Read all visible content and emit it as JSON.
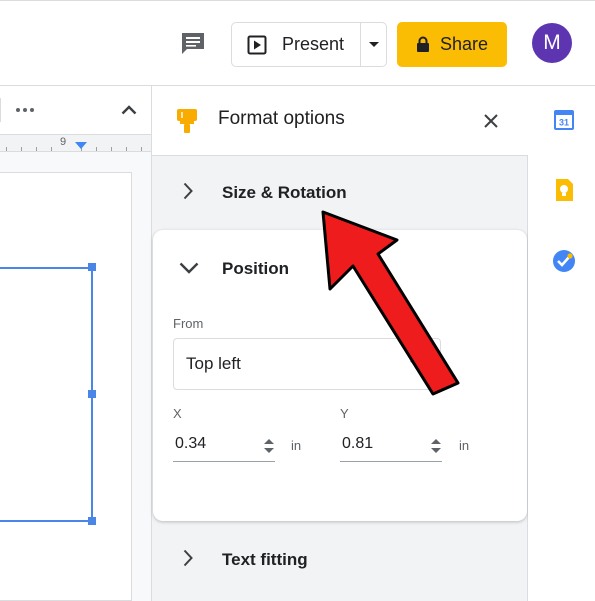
{
  "header": {
    "present_label": "Present",
    "share_label": "Share",
    "avatar_initial": "M",
    "icons": [
      "comment-icon",
      "present-icon",
      "dropdown-caret-icon",
      "lock-icon"
    ],
    "colors": {
      "share": "#fbbc04",
      "avatar": "#5e35b1"
    }
  },
  "toolbar": {
    "icons": [
      "more-icon",
      "collapse-icon"
    ]
  },
  "ruler": {
    "visible_number": "9"
  },
  "format_panel": {
    "title": "Format options",
    "icons": [
      "paint-brush-icon",
      "close-icon"
    ],
    "sections": {
      "size_rotation": {
        "label": "Size & Rotation",
        "expanded": false
      },
      "position": {
        "label": "Position",
        "expanded": true,
        "from_label": "From",
        "from_value": "Top left",
        "x_label": "X",
        "x_value": "0.34",
        "x_unit": "in",
        "y_label": "Y",
        "y_value": "0.81",
        "y_unit": "in"
      },
      "text_fitting": {
        "label": "Text fitting",
        "expanded": false
      }
    }
  },
  "right_sidebar": {
    "icons": [
      "calendar-icon",
      "keep-icon",
      "tasks-icon"
    ],
    "calendar_day": "31"
  },
  "annotation": {
    "type": "red-arrow",
    "points_to": "Size & Rotation",
    "color": "#ee1c1c"
  }
}
